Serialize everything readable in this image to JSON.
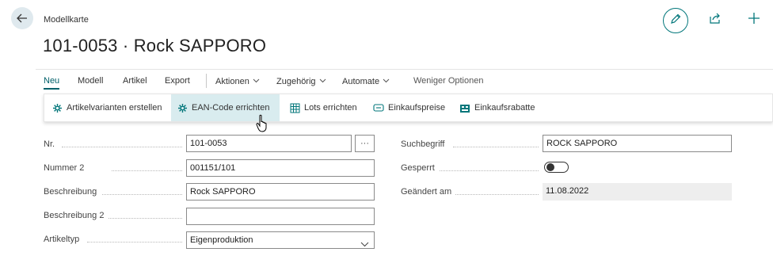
{
  "header": {
    "caption": "Modellkarte",
    "title": "101-0053 · Rock SAPPORO"
  },
  "icons": {
    "back": "arrow-left-icon",
    "edit": "pencil-icon",
    "share": "share-icon",
    "add": "plus-icon",
    "cursor": "hand-pointer-icon"
  },
  "colors": {
    "accent": "#00767a",
    "ribbon_highlight": "#d9ecef",
    "back_button_bg": "#dfe9ee",
    "readonly_bg": "#eeeeee"
  },
  "action_bar": {
    "items": [
      {
        "label": "Neu",
        "active": true
      },
      {
        "label": "Modell"
      },
      {
        "label": "Artikel"
      },
      {
        "label": "Export"
      },
      {
        "label": "Aktionen",
        "dropdown": true
      },
      {
        "label": "Zugehörig",
        "dropdown": true
      },
      {
        "label": "Automate",
        "dropdown": true
      },
      {
        "label": "Weniger Optionen"
      }
    ]
  },
  "ribbon": {
    "buttons": [
      {
        "label": "Artikelvarianten erstellen",
        "icon": "gear-icon"
      },
      {
        "label": "EAN-Code errichten",
        "icon": "gear-icon",
        "highlighted": true
      },
      {
        "label": "Lots errichten",
        "icon": "grid-icon"
      },
      {
        "label": "Einkaufspreise",
        "icon": "price-tag-icon"
      },
      {
        "label": "Einkaufsrabatte",
        "icon": "discount-icon"
      }
    ]
  },
  "form": {
    "left": [
      {
        "label": "Nr.",
        "value": "101-0053"
      },
      {
        "label": "Nummer 2",
        "value": "001151/101"
      },
      {
        "label": "Beschreibung",
        "value": "Rock SAPPORO"
      },
      {
        "label": "Beschreibung 2",
        "value": ""
      },
      {
        "label": "Artikeltyp",
        "value": "Eigenproduktion"
      }
    ],
    "right": [
      {
        "label": "Suchbegriff",
        "value": "ROCK SAPPORO"
      },
      {
        "label": "Gesperrt",
        "value": false
      },
      {
        "label": "Geändert am",
        "value": "11.08.2022"
      }
    ],
    "assist_label": "···"
  }
}
